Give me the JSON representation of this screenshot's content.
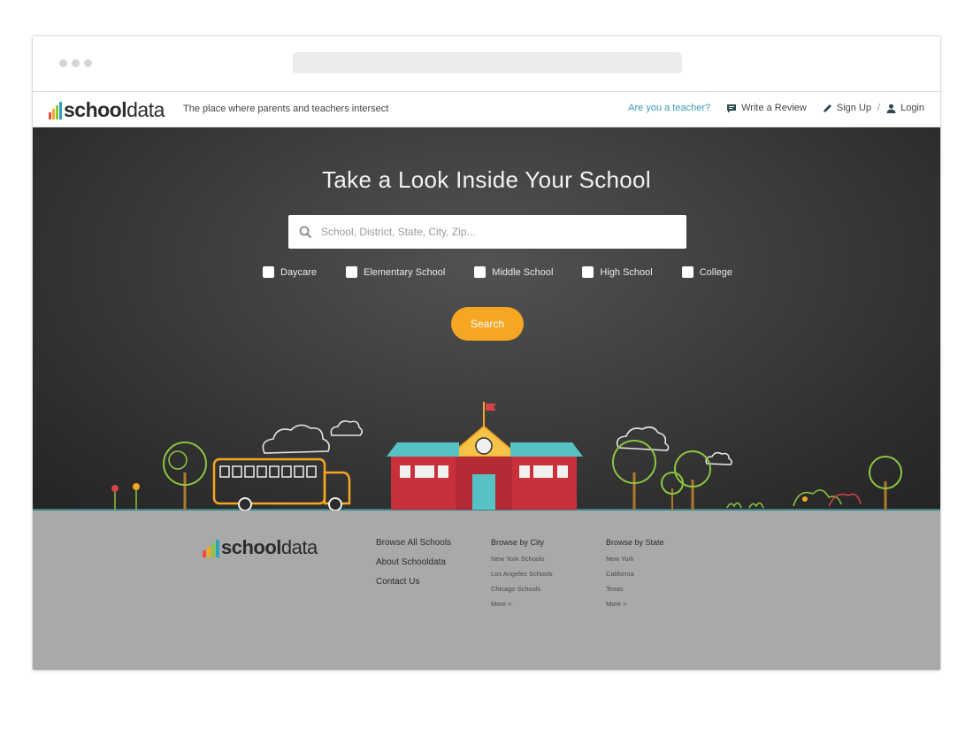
{
  "brand": {
    "name_bold": "school",
    "name_light": "data",
    "bar_colors": [
      "#e94e3c",
      "#f5a623",
      "#8cc63f",
      "#2ea3b9"
    ]
  },
  "navbar": {
    "tagline": "The place where parents and teachers intersect",
    "teacher_link": "Are you a teacher?",
    "write_review": "Write a Review",
    "sign_up": "Sign Up",
    "separator": "/",
    "login": "Login"
  },
  "hero": {
    "title": "Take a Look Inside Your School",
    "search_placeholder": "School, District, State, City, Zip...",
    "filters": [
      "Daycare",
      "Elementary School",
      "Middle School",
      "High School",
      "College"
    ],
    "search_button": "Search"
  },
  "footer": {
    "links": [
      "Browse All Schools",
      "About Schooldata",
      "Contact Us"
    ],
    "city": {
      "heading": "Browse by City",
      "items": [
        "New York Schools",
        "Los Angeles Schools",
        "Chicago Schools",
        "More >"
      ]
    },
    "state": {
      "heading": "Browse by State",
      "items": [
        "New York",
        "California",
        "Texas",
        "More >"
      ]
    }
  },
  "colors": {
    "accent_orange": "#f5a623",
    "link_teal": "#3a9bb6",
    "chalkboard": "#3a3a3a",
    "footer_gray": "#a9a9a9"
  }
}
